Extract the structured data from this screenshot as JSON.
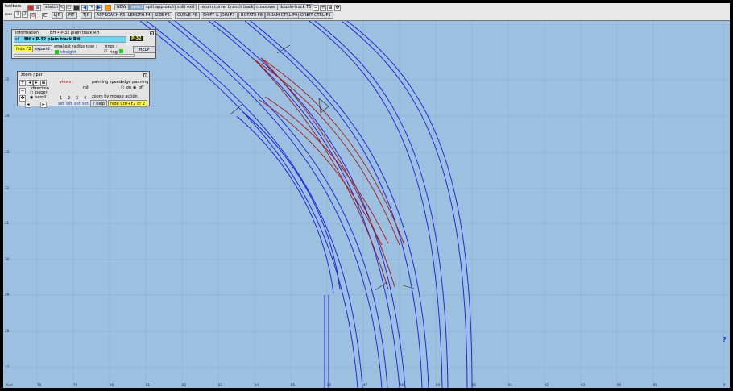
{
  "toolbar": {
    "label": "toolbars",
    "rows_label": "rows",
    "rows": [
      "1",
      "2"
    ],
    "btn_sketch": "sketch",
    "btn_new": "NEW",
    "btn_select": "select",
    "split_approach": "split approach",
    "split_exit": "split exit",
    "return_curve": "return curve",
    "branch_track": "branch track",
    "crossover": "crossover",
    "double_track": "double-track T5",
    "undo": "0",
    "redo": "C",
    "lr": "L|R",
    "fit": "FIT",
    "tjp": "T|P",
    "approach": "APPROACH F3",
    "length": "LENGTH F4",
    "size": "SIZE F5",
    "curve": "CURVE F6",
    "shift_join": "SHIFT & JOIN F7",
    "rotate": "ROTATE F8",
    "roam": "ROAM CTRL-F9",
    "orbit": "ORBIT CTRL-F5"
  },
  "info_panel": {
    "title": "information",
    "subtitle": "BH • P-32 plain track RH",
    "tag_st": "st",
    "name": "BH • P-32 plain track RH",
    "badge": "P-32",
    "hide": "hide F2",
    "expand": "expand",
    "smallest_radius_label": "smallest radius now :",
    "smallest_radius_value": "straight",
    "rings_label": "rings :",
    "ring_label": "ring",
    "help": "HELP"
  },
  "zoom_panel": {
    "title": "zoom / pan",
    "direction": "direction",
    "paper": "paper",
    "scroll": "scroll",
    "views_label": "views :",
    "roll": "roll",
    "view_numbers": [
      "1",
      "2",
      "3",
      "4"
    ],
    "set": "set",
    "panning_speed": "panning speed",
    "edge_panning": "edge panning",
    "on": "on",
    "off": "off",
    "zoom_by_mouse": "zoom by mouse action",
    "help": "? help",
    "hide": "hide  Ctrl+F2 or 2"
  },
  "grid": {
    "y_labels": [
      "35",
      "34",
      "33",
      "32",
      "31",
      "30",
      "29",
      "28",
      "27"
    ],
    "x_labels": [
      "feet",
      "78",
      "79",
      "80",
      "81",
      "82",
      "83",
      "84",
      "85",
      "86",
      "87",
      "88",
      "89",
      "90",
      "91",
      "92",
      "93",
      "94",
      "95",
      "9"
    ]
  },
  "status": {
    "question": "?"
  },
  "colors": {
    "canvas": "#9ec0e0",
    "track_blue": "#1a1adc",
    "track_red": "#a01818",
    "gridline": "#7fa4c8"
  }
}
